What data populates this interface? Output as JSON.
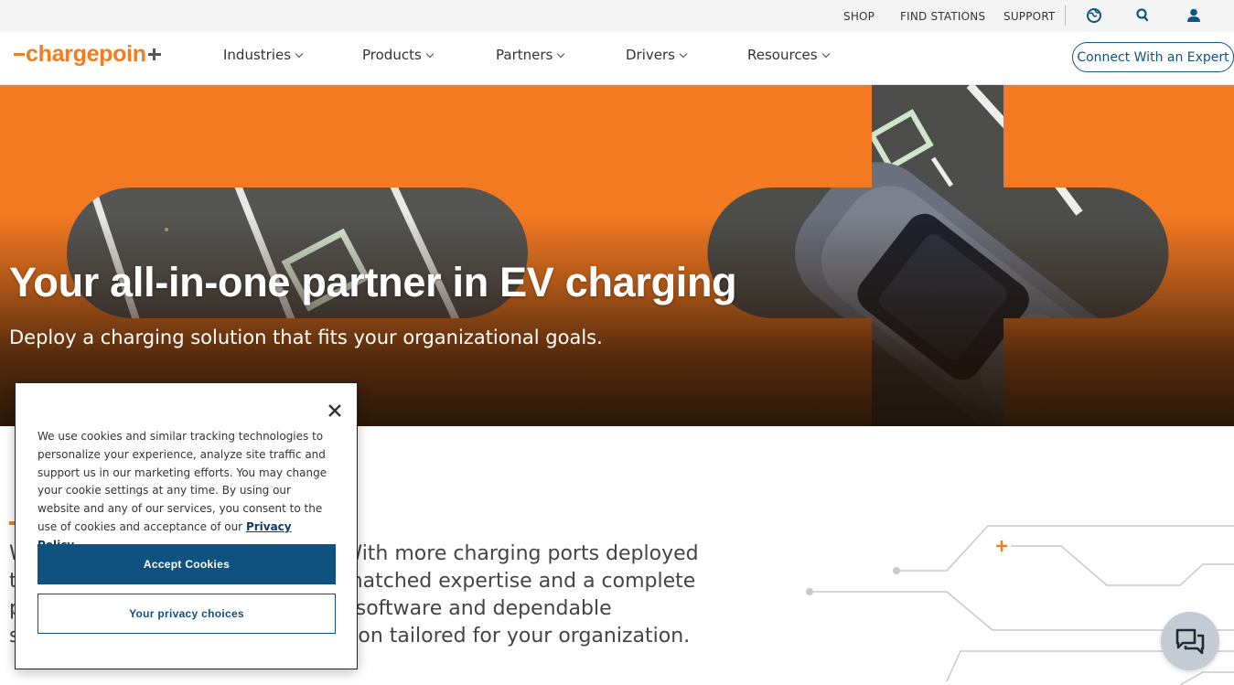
{
  "utility": {
    "shop": "SHOP",
    "find_stations": "FIND STATIONS",
    "support": "SUPPORT",
    "icons": [
      "globe-icon",
      "search-icon",
      "user-icon"
    ]
  },
  "nav": {
    "logo_text": "chargepoin",
    "items": [
      {
        "label": "Industries"
      },
      {
        "label": "Products"
      },
      {
        "label": "Partners"
      },
      {
        "label": "Drivers"
      },
      {
        "label": "Resources"
      }
    ],
    "cta": "Connect With an Expert"
  },
  "hero": {
    "title": "Your all-in-one partner in EV charging",
    "subtitle": "Deploy a charging solution that fits your organizational goals."
  },
  "body": {
    "line1": "W                                               . With more charging ports deployed",
    "line2": "t                                               unmatched expertise and a complete",
    "line3": "p                                              ent software and dependable",
    "line4": "s                                              olution tailored for your organization."
  },
  "cookie": {
    "text": "We use cookies and similar tracking technologies to personalize your experience, analyze site traffic and support us in our marketing efforts. You may change your cookie settings at any time. By using our website and any of our services, you consent to the use of cookies and acceptance of our",
    "privacy_link": "Privacy Policy",
    "accept": "Accept Cookies",
    "choices": "Your privacy choices"
  },
  "colors": {
    "brand_orange": "#f37b20",
    "brand_blue": "#0f5280",
    "hero_orange": "#f47a22"
  }
}
